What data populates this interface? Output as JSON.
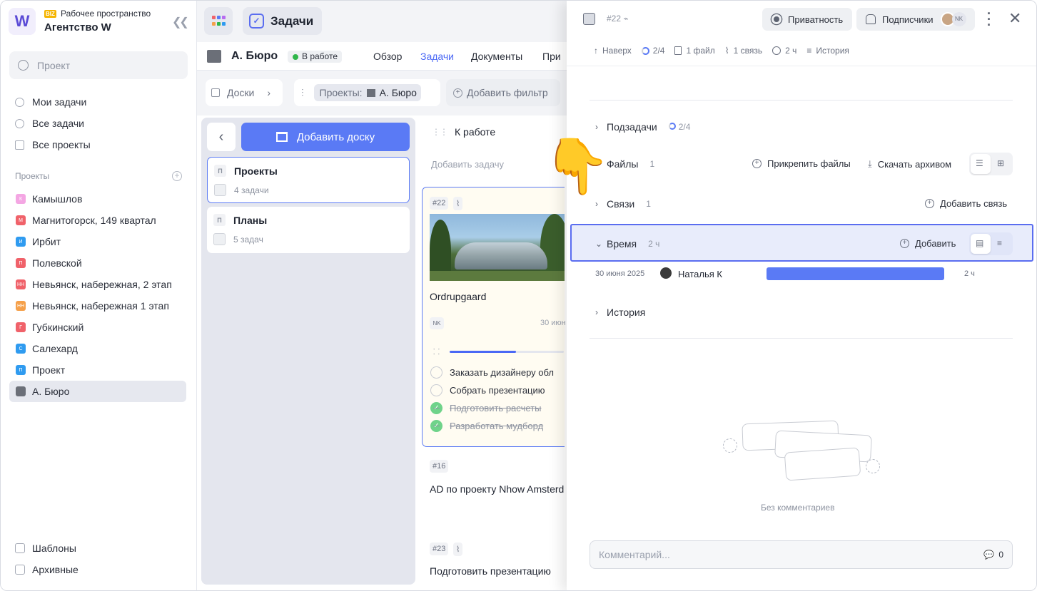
{
  "workspace": {
    "badge": "BIZ",
    "subtitle": "Рабочее пространство",
    "title": "Агентство W",
    "logo": "W"
  },
  "search": {
    "placeholder": "Проект"
  },
  "nav": [
    {
      "label": "Мои задачи",
      "icon": "check-circle-icon"
    },
    {
      "label": "Все задачи",
      "icon": "check-circle-icon"
    },
    {
      "label": "Все проекты",
      "icon": "folder-icon"
    }
  ],
  "projects_header": "Проекты",
  "projects": [
    {
      "letter": "К",
      "label": "Камышлов",
      "color": "#f4a6e3"
    },
    {
      "letter": "М",
      "label": "Магнитогорск, 149 квартал",
      "color": "#f0626a"
    },
    {
      "letter": "И",
      "label": "Ирбит",
      "color": "#2f9bf0"
    },
    {
      "letter": "П",
      "label": "Полевской",
      "color": "#f0626a"
    },
    {
      "letter": "НН",
      "label": "Невьянск, набережная, 2 этап",
      "color": "#f0626a"
    },
    {
      "letter": "НН",
      "label": "Невьянск, набережная 1 этап",
      "color": "#f5a04a"
    },
    {
      "letter": "Г",
      "label": "Губкинский",
      "color": "#f0626a"
    },
    {
      "letter": "С",
      "label": "Салехард",
      "color": "#2f9bf0"
    },
    {
      "letter": "П",
      "label": "Проект",
      "color": "#2f9bf0"
    },
    {
      "letter": "",
      "label": "А. Бюро",
      "color": "#6b6f78"
    }
  ],
  "footer": {
    "templates": "Шаблоны",
    "archived": "Архивные"
  },
  "topbar": {
    "tab": "Задачи"
  },
  "project": {
    "title": "А. Бюро",
    "status": "В работе",
    "tabs": [
      "Обзор",
      "Задачи",
      "Документы",
      "При"
    ]
  },
  "filters": {
    "boards": "Доски",
    "projects_label": "Проекты:",
    "project_chip": "А. Бюро",
    "add_filter": "Добавить фильтр"
  },
  "boards": {
    "add": "Добавить доску",
    "items": [
      {
        "letter": "П",
        "title": "Проекты",
        "count": "4 задачи"
      },
      {
        "letter": "П",
        "title": "Планы",
        "count": "5 задач"
      }
    ]
  },
  "column": {
    "title": "К работе",
    "add_task": "Добавить задачу"
  },
  "task_main": {
    "id": "#22",
    "title": "Ordrupgaard",
    "assignee": "NK",
    "date": "30 июн",
    "progress": 0.58,
    "checklist": [
      {
        "label": "Заказать дизайнеру обл",
        "done": false
      },
      {
        "label": "Собрать презентацию",
        "done": false
      },
      {
        "label": "Подготовить расчеты",
        "done": true
      },
      {
        "label": "Разработать мудборд",
        "done": true
      }
    ]
  },
  "tasks": [
    {
      "id": "#16",
      "title": "AD по проекту Nhow Amsterd"
    },
    {
      "id": "#23",
      "title": "Подготовить презентацию"
    }
  ],
  "panel": {
    "id": "#22",
    "privacy": "Приватность",
    "subscribers": "Подписчики",
    "subscriber_initials": "NK",
    "meta": {
      "up": "Наверх",
      "subtasks": "2/4",
      "files": "1 файл",
      "links": "1 связь",
      "time": "2 ч",
      "history": "История"
    },
    "sections": {
      "subtasks": {
        "label": "Подзадачи",
        "count": "2/4"
      },
      "files": {
        "label": "Файлы",
        "count": "1",
        "attach": "Прикрепить файлы",
        "download": "Скачать архивом"
      },
      "links": {
        "label": "Связи",
        "count": "1",
        "add": "Добавить связь"
      },
      "time": {
        "label": "Время",
        "count": "2 ч",
        "add": "Добавить"
      },
      "history": {
        "label": "История"
      }
    },
    "time_log": {
      "date": "30 июня 2025",
      "user": "Наталья К",
      "duration": "2 ч"
    },
    "no_comments": "Без комментариев",
    "comment_placeholder": "Комментарий...",
    "comment_count": "0"
  }
}
